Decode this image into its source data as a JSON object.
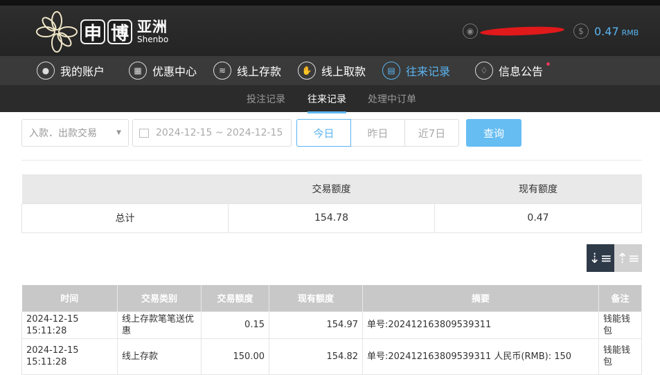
{
  "brand": {
    "chars": [
      "申",
      "博"
    ],
    "cn": "亚洲",
    "en": "Shenbo"
  },
  "account": {
    "balance": "0.47",
    "currency": "RMB"
  },
  "nav": [
    {
      "label": "我的账户",
      "icon": "user-icon"
    },
    {
      "label": "优惠中心",
      "icon": "gift-icon"
    },
    {
      "label": "线上存款",
      "icon": "deposit-icon"
    },
    {
      "label": "线上取款",
      "icon": "withdraw-icon"
    },
    {
      "label": "往来记录",
      "icon": "record-icon"
    },
    {
      "label": "信息公告",
      "icon": "bell-icon"
    }
  ],
  "subnav": [
    "投注记录",
    "往来记录",
    "处理中订单"
  ],
  "filters": {
    "type": "入款．出款交易",
    "date_range": "2024-12-15 ~ 2024-12-15",
    "quick": [
      "今日",
      "昨日",
      "近7日"
    ],
    "query": "查询"
  },
  "summary": {
    "headers": [
      "",
      "交易额度",
      "现有额度"
    ],
    "row": [
      "总计",
      "154.78",
      "0.47"
    ]
  },
  "records": {
    "headers": [
      "时间",
      "交易类别",
      "交易额度",
      "现有额度",
      "摘要",
      "备注"
    ],
    "rows": [
      [
        "2024-12-15 15:11:28",
        "线上存款笔笔送优惠",
        "0.15",
        "154.97",
        "单号:202412163809539311",
        "钱能钱包"
      ],
      [
        "2024-12-15 15:11:28",
        "线上存款",
        "150.00",
        "154.82",
        "单号:202412163809539311 人民币(RMB): 150",
        "钱能钱包"
      ]
    ]
  }
}
